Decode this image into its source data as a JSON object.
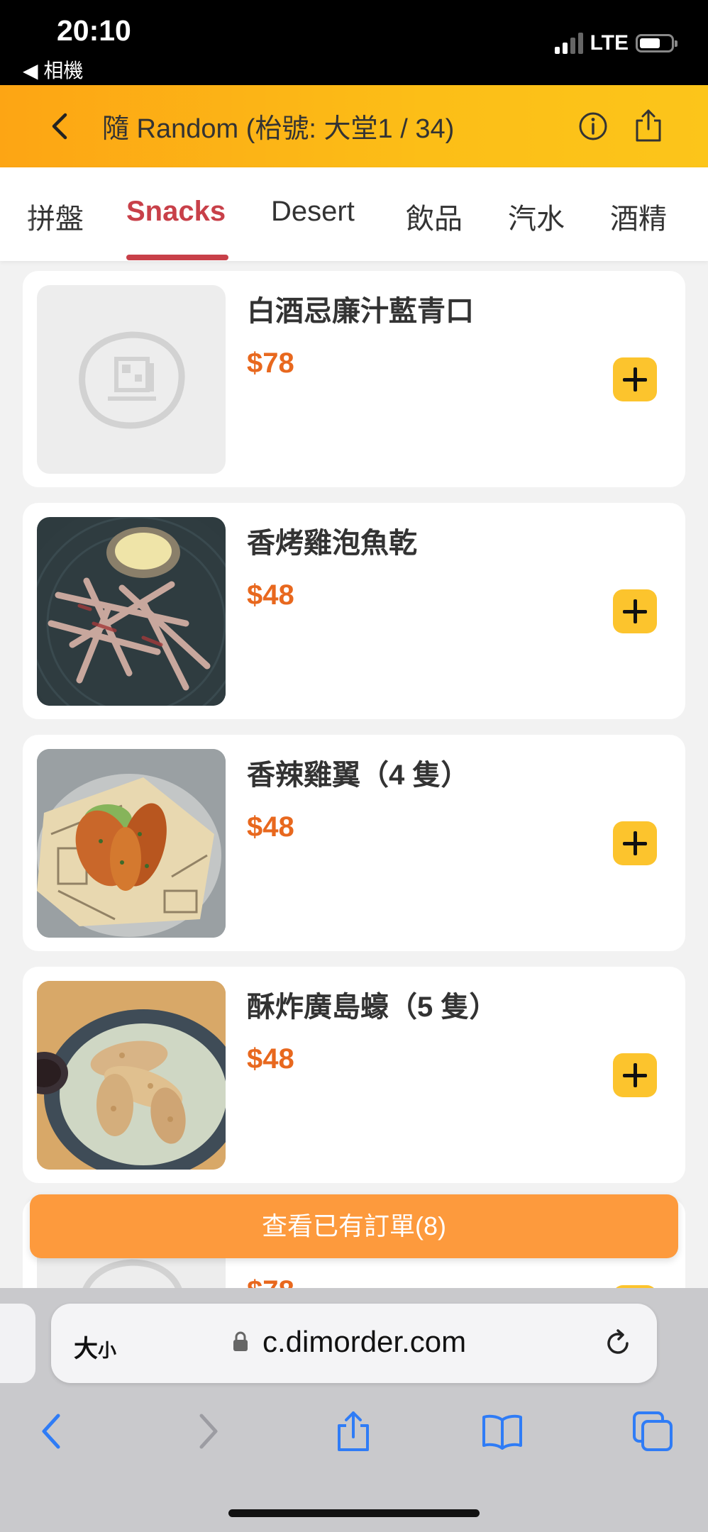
{
  "status_bar": {
    "time": "20:10",
    "back_app": "◀ 相機",
    "network": "LTE"
  },
  "header": {
    "title": "隨 Random (枱號: 大堂1 / 34)"
  },
  "tabs": [
    {
      "label": "拼盤",
      "active": false
    },
    {
      "label": "Snacks",
      "active": true
    },
    {
      "label": "Desert",
      "active": false
    },
    {
      "label": "飲品",
      "active": false
    },
    {
      "label": "汽水",
      "active": false
    },
    {
      "label": "酒精",
      "active": false
    }
  ],
  "items": [
    {
      "name": "白酒忌廉汁藍青口",
      "price": "$78",
      "image": "placeholder-logo"
    },
    {
      "name": "香烤雞泡魚乾",
      "price": "$48",
      "image": "dried-fish-photo"
    },
    {
      "name": "香辣雞翼（4 隻）",
      "price": "$48",
      "image": "chicken-wings-photo"
    },
    {
      "name": "酥炸廣島蠔（5 隻）",
      "price": "$48",
      "image": "fried-oysters-photo"
    },
    {
      "name": "",
      "price": "$78",
      "image": "placeholder-logo"
    }
  ],
  "order_button": {
    "label": "查看已有訂單(8)"
  },
  "safari": {
    "text_size_label": "大",
    "text_size_small": "小",
    "url": "c.dimorder.com"
  },
  "colors": {
    "header_gradient_start": "#fda514",
    "header_gradient_end": "#fcc51a",
    "tab_active": "#c84049",
    "price": "#e8681e",
    "add_button": "#fcc42d",
    "order_button": "#fd9a3d",
    "safari_blue": "#2f7cf6"
  }
}
